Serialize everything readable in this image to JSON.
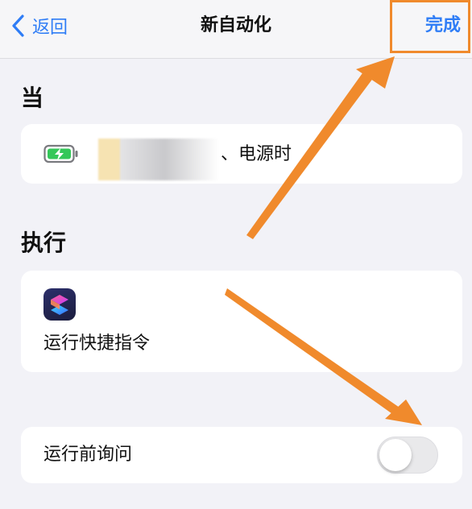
{
  "nav": {
    "back_label": "返回",
    "title": "新自动化",
    "done_label": "完成"
  },
  "sections": {
    "when_title": "当",
    "do_title": "执行"
  },
  "trigger": {
    "icon": "battery-charging-icon",
    "text": "、电源时"
  },
  "action": {
    "icon": "shortcuts-app-icon",
    "label": "运行快捷指令"
  },
  "ask_before_running": {
    "label": "运行前询问",
    "enabled": false
  },
  "colors": {
    "accent": "#2f7df6",
    "annotation": "#f08a2c",
    "battery_green": "#34c759"
  }
}
